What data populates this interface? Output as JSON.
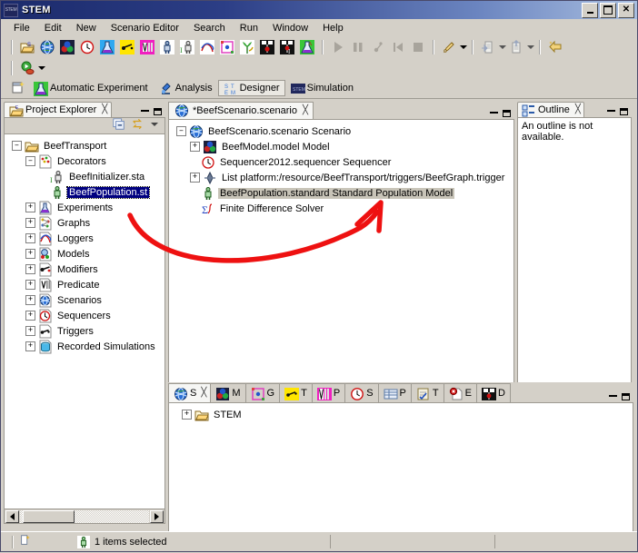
{
  "window": {
    "title": "STEM",
    "icon": "stem-logo-icon",
    "minimize": "–",
    "maximize": "□",
    "close": "×"
  },
  "menubar": {
    "items": [
      {
        "label": "File"
      },
      {
        "label": "Edit"
      },
      {
        "label": "New"
      },
      {
        "label": "Scenario Editor"
      },
      {
        "label": "Search"
      },
      {
        "label": "Run"
      },
      {
        "label": "Window"
      },
      {
        "label": "Help"
      }
    ]
  },
  "toolbar": {
    "row1": [
      {
        "name": "open-project-icon"
      },
      {
        "name": "globe-icon"
      },
      {
        "name": "model-icon"
      },
      {
        "name": "sequencer-clock-icon"
      },
      {
        "name": "experiment-flask-icon"
      },
      {
        "name": "trigger-icon"
      },
      {
        "name": "predicate-icon"
      },
      {
        "name": "population-icon"
      },
      {
        "name": "population-initializer-icon"
      },
      {
        "name": "logger-icon"
      },
      {
        "name": "graph-icon"
      },
      {
        "name": "plant-icon"
      },
      {
        "name": "decorator-icon"
      },
      {
        "name": "decorator-initializer-icon"
      },
      {
        "name": "automatic-experiment-icon"
      }
    ],
    "row1b": [
      {
        "name": "run-play-icon"
      },
      {
        "name": "pause-icon"
      },
      {
        "name": "step-icon"
      },
      {
        "name": "reset-icon"
      },
      {
        "name": "stop-icon"
      },
      {
        "name": "run-configuration-icon"
      },
      {
        "name": "import-icon"
      },
      {
        "name": "export-icon"
      },
      {
        "name": "jump-back-icon"
      }
    ],
    "row2": [
      {
        "name": "run-stem-icon"
      }
    ]
  },
  "perspectives": {
    "new-wizard-icon": "new-wizard-icon",
    "items": [
      {
        "label": "Automatic Experiment",
        "icon": "automatic-experiment-icon",
        "active": false
      },
      {
        "label": "Analysis",
        "icon": "analysis-microscope-icon",
        "active": false
      },
      {
        "label": "Designer",
        "icon": "designer-stem-icon",
        "active": true
      },
      {
        "label": "Simulation",
        "icon": "simulation-stem-icon",
        "active": false
      }
    ]
  },
  "project_explorer": {
    "tab_label": "Project Explorer",
    "tab_icon": "project-explorer-icon",
    "close_glyph": "╳",
    "toolbar": [
      {
        "name": "collapse-all-icon"
      },
      {
        "name": "link-with-editor-icon"
      },
      {
        "name": "view-menu-icon"
      }
    ],
    "tree": [
      {
        "label": "BeefTransport",
        "depth": 0,
        "expander": "-",
        "icon": "folder-project-icon",
        "selected": "none"
      },
      {
        "label": "Decorators",
        "depth": 1,
        "expander": "-",
        "icon": "decorators-folder-icon",
        "selected": "none"
      },
      {
        "label": "BeefInitializer.sta",
        "depth": 2,
        "expander": "",
        "icon": "population-initializer-icon",
        "selected": "none"
      },
      {
        "label": "BeefPopulation.st",
        "depth": 2,
        "expander": "",
        "icon": "population-icon",
        "selected": "blue"
      },
      {
        "label": "Experiments",
        "depth": 1,
        "expander": "+",
        "icon": "experiments-folder-icon",
        "selected": "none"
      },
      {
        "label": "Graphs",
        "depth": 1,
        "expander": "+",
        "icon": "graphs-folder-icon",
        "selected": "none"
      },
      {
        "label": "Loggers",
        "depth": 1,
        "expander": "+",
        "icon": "loggers-folder-icon",
        "selected": "none"
      },
      {
        "label": "Models",
        "depth": 1,
        "expander": "+",
        "icon": "models-folder-icon",
        "selected": "none"
      },
      {
        "label": "Modifiers",
        "depth": 1,
        "expander": "+",
        "icon": "modifiers-folder-icon",
        "selected": "none"
      },
      {
        "label": "Predicate",
        "depth": 1,
        "expander": "+",
        "icon": "predicate-folder-icon",
        "selected": "none"
      },
      {
        "label": "Scenarios",
        "depth": 1,
        "expander": "+",
        "icon": "scenarios-folder-icon",
        "selected": "none"
      },
      {
        "label": "Sequencers",
        "depth": 1,
        "expander": "+",
        "icon": "sequencers-folder-icon",
        "selected": "none"
      },
      {
        "label": "Triggers",
        "depth": 1,
        "expander": "+",
        "icon": "triggers-folder-icon",
        "selected": "none"
      },
      {
        "label": "Recorded Simulations",
        "depth": 1,
        "expander": "+",
        "icon": "recorded-simulations-folder-icon",
        "selected": "none"
      }
    ],
    "hscroll": {
      "thumb_left_pct": 4,
      "thumb_width_pct": 38
    }
  },
  "editor": {
    "tab_label": "*BeefScenario.scenario",
    "tab_icon": "scenario-globe-icon",
    "close_glyph": "╳",
    "tree": [
      {
        "label": "BeefScenario.scenario Scenario",
        "depth": 0,
        "expander": "-",
        "icon": "scenario-globe-icon",
        "selected": "none"
      },
      {
        "label": "BeefModel.model Model",
        "depth": 1,
        "expander": "+",
        "icon": "model-icon",
        "selected": "none"
      },
      {
        "label": "Sequencer2012.sequencer Sequencer",
        "depth": 1,
        "expander": "",
        "icon": "sequencer-clock-icon",
        "selected": "none"
      },
      {
        "label": "List platform:/resource/BeefTransport/triggers/BeefGraph.trigger",
        "depth": 1,
        "expander": "+",
        "icon": "list-diamond-icon",
        "selected": "none"
      },
      {
        "label": "BeefPopulation.standard Standard Population Model",
        "depth": 1,
        "expander": "",
        "icon": "population-icon",
        "selected": "grey"
      },
      {
        "label": "Finite Difference Solver",
        "depth": 1,
        "expander": "",
        "icon": "solver-sigma-icon",
        "selected": "none"
      }
    ],
    "hscroll": {
      "thumb_left_pct": 1,
      "thumb_width_pct": 92
    }
  },
  "outline": {
    "tab_label": "Outline",
    "tab_icon": "outline-icon",
    "close_glyph": "╳",
    "message_line1": "An outline is not",
    "message_line2": "available."
  },
  "bottom_stack": {
    "tabs": [
      {
        "label": "S",
        "icon": "scenario-globe-icon",
        "active": true,
        "close_glyph": "╳"
      },
      {
        "label": "M",
        "icon": "model-icon",
        "active": false
      },
      {
        "label": "G",
        "icon": "graph-icon",
        "active": false
      },
      {
        "label": "T",
        "icon": "trigger-icon",
        "active": false
      },
      {
        "label": "P",
        "icon": "predicate-icon",
        "active": false
      },
      {
        "label": "S",
        "icon": "sequencer-clock-icon",
        "active": false
      },
      {
        "label": "P",
        "icon": "properties-table-icon",
        "active": false
      },
      {
        "label": "T",
        "icon": "tasks-clipboard-icon",
        "active": false
      },
      {
        "label": "E",
        "icon": "error-log-icon",
        "active": false
      },
      {
        "label": "D",
        "icon": "decorator-icon",
        "active": false
      }
    ],
    "tree": [
      {
        "label": "STEM",
        "depth": 0,
        "expander": "+",
        "icon": "folder-icon"
      }
    ]
  },
  "statusbar": {
    "left_icon": "new-item-icon",
    "selection_icon": "population-icon",
    "selection_text": "1 items selected"
  },
  "annotation": {
    "name": "red-curved-arrow",
    "color": "#ee1111",
    "from": "BeefPopulation.st tree item",
    "to": "BeefPopulation.standard Standard Population Model"
  }
}
